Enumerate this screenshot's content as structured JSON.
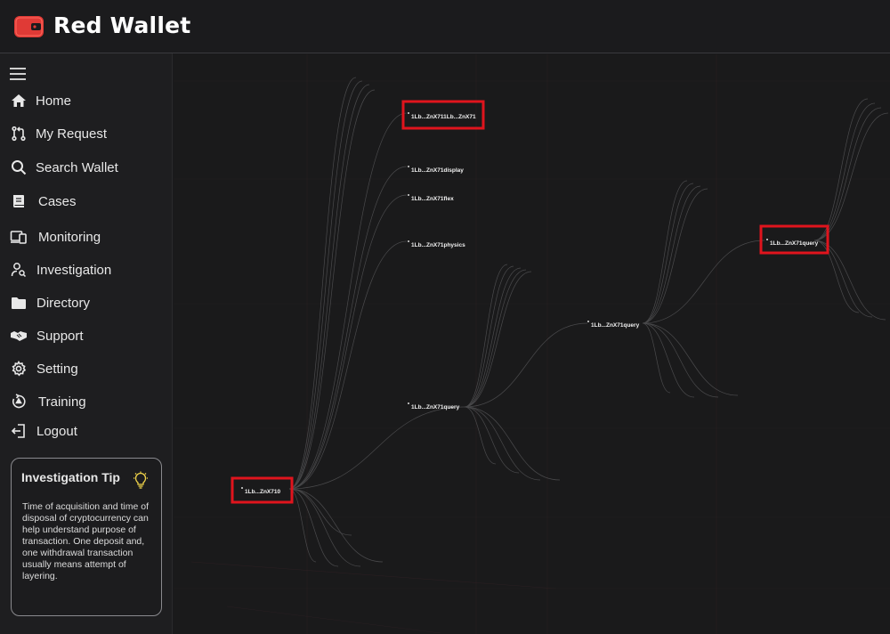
{
  "app": {
    "title": "Red Wallet"
  },
  "colors": {
    "brand": "#e03a36",
    "highlight": "#e0141d",
    "background": "#1a1a1c"
  },
  "sidebar": {
    "items": [
      {
        "label": "Home",
        "icon": "home-icon"
      },
      {
        "label": "My Request",
        "icon": "pull-request-icon"
      },
      {
        "label": "Search Wallet",
        "icon": "search-icon"
      },
      {
        "label": "Cases",
        "icon": "book-icon"
      },
      {
        "label": "Monitoring",
        "icon": "devices-icon"
      },
      {
        "label": "Investigation",
        "icon": "person-search-icon"
      },
      {
        "label": "Directory",
        "icon": "folder-icon"
      },
      {
        "label": "Support",
        "icon": "handshake-icon"
      },
      {
        "label": "Setting",
        "icon": "gear-icon"
      },
      {
        "label": "Training",
        "icon": "training-icon"
      },
      {
        "label": "Logout",
        "icon": "logout-icon"
      }
    ],
    "tip": {
      "title": "Investigation Tip",
      "icon": "lightbulb-icon",
      "text": "Time of acquisition and time of disposal of cryptocurrency can help understand purpose of transaction. One deposit and, one withdrawal transaction usually means attempt of layering."
    }
  },
  "graph": {
    "nodes": [
      {
        "id": "root",
        "label": "1Lb...ZnX710",
        "highlighted": true
      },
      {
        "id": "n1",
        "label": "1Lb...ZnX711Lb...ZnX71",
        "highlighted": true
      },
      {
        "id": "n2",
        "label": "1Lb...ZnX71display",
        "highlighted": false
      },
      {
        "id": "n3",
        "label": "1Lb...ZnX71flex",
        "highlighted": false
      },
      {
        "id": "n4",
        "label": "1Lb...ZnX71physics",
        "highlighted": false
      },
      {
        "id": "n5",
        "label": "1Lb...ZnX71query",
        "highlighted": false
      },
      {
        "id": "n6",
        "label": "1Lb...ZnX71query",
        "highlighted": false
      },
      {
        "id": "n7",
        "label": "1Lb...ZnX71query",
        "highlighted": true
      }
    ]
  }
}
